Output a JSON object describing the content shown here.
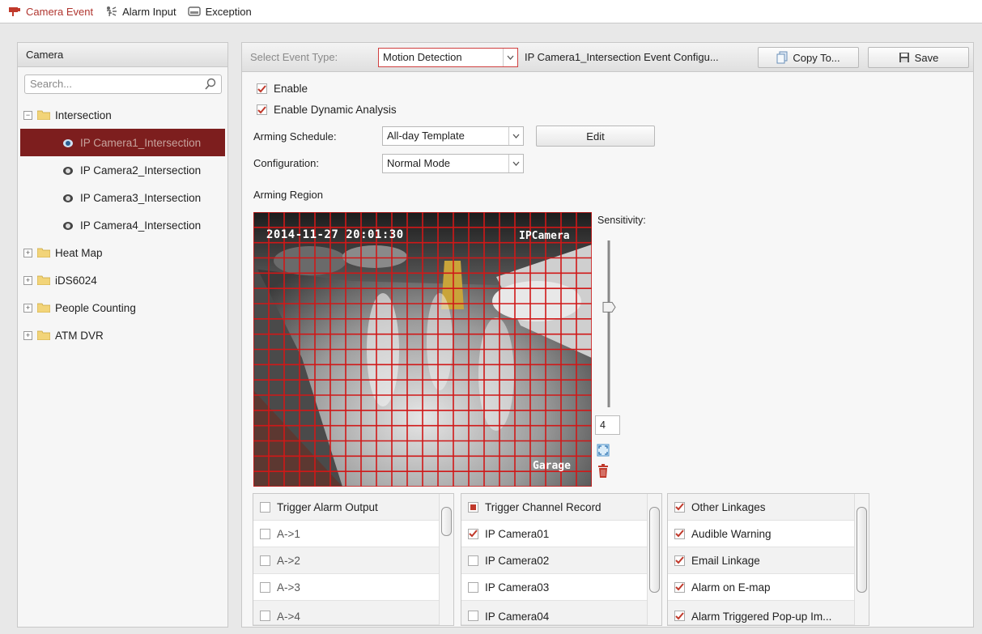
{
  "tabs": [
    {
      "label": "Camera Event",
      "icon": "camera-event-icon",
      "active": true
    },
    {
      "label": "Alarm Input",
      "icon": "alarm-input-icon",
      "active": false
    },
    {
      "label": "Exception",
      "icon": "exception-icon",
      "active": false
    }
  ],
  "camera_panel": {
    "title": "Camera",
    "search_placeholder": "Search...",
    "tree": [
      {
        "label": "Intersection",
        "type": "group",
        "expanded": true
      },
      {
        "label": "IP Camera1_Intersection",
        "type": "camera",
        "selected": true
      },
      {
        "label": "IP Camera2_Intersection",
        "type": "camera"
      },
      {
        "label": "IP Camera3_Intersection",
        "type": "camera"
      },
      {
        "label": "IP Camera4_Intersection",
        "type": "camera"
      },
      {
        "label": "Heat Map",
        "type": "group",
        "expanded": false
      },
      {
        "label": "iDS6024",
        "type": "group",
        "expanded": false
      },
      {
        "label": "People Counting",
        "type": "group",
        "expanded": false
      },
      {
        "label": "ATM DVR",
        "type": "group",
        "expanded": false
      }
    ]
  },
  "toolbar": {
    "event_type_label": "Select Event Type:",
    "event_type_value": "Motion Detection",
    "config_title": "IP Camera1_Intersection Event Configu...",
    "copy_label": "Copy To...",
    "save_label": "Save"
  },
  "form": {
    "enable_label": "Enable",
    "dynamic_label": "Enable Dynamic Analysis",
    "schedule_label": "Arming Schedule:",
    "schedule_value": "All-day Template",
    "edit_label": "Edit",
    "config_label": "Configuration:",
    "config_value": "Normal Mode",
    "region_label": "Arming Region"
  },
  "video": {
    "timestamp": "2014-11-27 20:01:30",
    "camera_name": "IPCamera",
    "location_name": "Garage"
  },
  "sensitivity": {
    "label": "Sensitivity:",
    "value": "4",
    "level_fraction": 0.4
  },
  "linkage": {
    "alarm_output": {
      "header": "Trigger Alarm Output",
      "items": [
        {
          "label": "A->1",
          "checked": false
        },
        {
          "label": "A->2",
          "checked": false
        },
        {
          "label": "A->3",
          "checked": false
        },
        {
          "label": "A->4",
          "checked": false
        }
      ]
    },
    "channel_record": {
      "header": "Trigger Channel Record",
      "items": [
        {
          "label": "IP Camera01",
          "checked": true
        },
        {
          "label": "IP Camera02",
          "checked": false
        },
        {
          "label": "IP Camera03",
          "checked": false
        },
        {
          "label": "IP Camera04",
          "checked": false
        }
      ]
    },
    "other": {
      "header": "Other Linkages",
      "items": [
        {
          "label": "Audible Warning",
          "checked": true
        },
        {
          "label": "Email Linkage",
          "checked": true
        },
        {
          "label": "Alarm on E-map",
          "checked": true
        },
        {
          "label": "Alarm Triggered Pop-up Im...",
          "checked": true
        }
      ]
    }
  },
  "colors": {
    "accent": "#b0352f",
    "selection": "#7d1e1e",
    "grid": "#d01818"
  }
}
